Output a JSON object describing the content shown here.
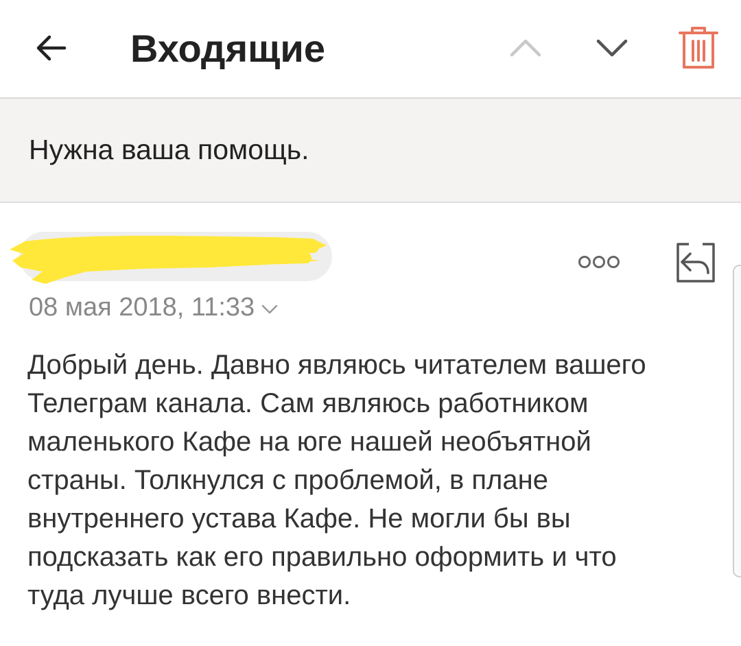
{
  "header": {
    "title": "Входящие",
    "icons": {
      "back": "arrow-left-icon",
      "prev": "chevron-up-icon",
      "next": "chevron-down-icon",
      "delete": "trash-icon"
    },
    "colors": {
      "delete_icon": "#e8765e",
      "prev_icon_disabled": "#c8c8c8",
      "next_icon": "#555555"
    }
  },
  "message": {
    "subject": "Нужна ваша помощь.",
    "sender_redacted": true,
    "redaction_color": "#ffe83a",
    "date": "08 мая 2018, 11:33",
    "more_icon": "more-dots-icon",
    "reply_icon": "reply-icon",
    "body_lines": [
      "Добрый день. Давно являюсь читателем вашего",
      "Телеграм канала. Сам являюсь работником",
      "маленького Кафе на юге нашей необъятной",
      "страны. Толкнулся с проблемой, в плане",
      "внутреннего устава Кафе. Не могли бы вы",
      "подсказать как его правильно оформить и что",
      "туда лучше всего внести."
    ]
  }
}
